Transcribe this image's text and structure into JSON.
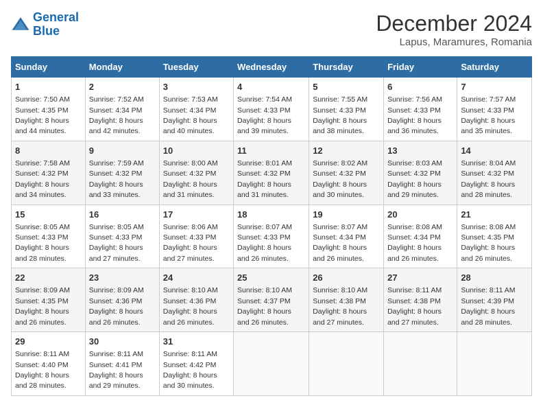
{
  "logo": {
    "line1": "General",
    "line2": "Blue"
  },
  "title": "December 2024",
  "location": "Lapus, Maramures, Romania",
  "days_of_week": [
    "Sunday",
    "Monday",
    "Tuesday",
    "Wednesday",
    "Thursday",
    "Friday",
    "Saturday"
  ],
  "weeks": [
    [
      {
        "day": 1,
        "sunrise": "7:50 AM",
        "sunset": "4:35 PM",
        "daylight": "8 hours and 44 minutes."
      },
      {
        "day": 2,
        "sunrise": "7:52 AM",
        "sunset": "4:34 PM",
        "daylight": "8 hours and 42 minutes."
      },
      {
        "day": 3,
        "sunrise": "7:53 AM",
        "sunset": "4:34 PM",
        "daylight": "8 hours and 40 minutes."
      },
      {
        "day": 4,
        "sunrise": "7:54 AM",
        "sunset": "4:33 PM",
        "daylight": "8 hours and 39 minutes."
      },
      {
        "day": 5,
        "sunrise": "7:55 AM",
        "sunset": "4:33 PM",
        "daylight": "8 hours and 38 minutes."
      },
      {
        "day": 6,
        "sunrise": "7:56 AM",
        "sunset": "4:33 PM",
        "daylight": "8 hours and 36 minutes."
      },
      {
        "day": 7,
        "sunrise": "7:57 AM",
        "sunset": "4:33 PM",
        "daylight": "8 hours and 35 minutes."
      }
    ],
    [
      {
        "day": 8,
        "sunrise": "7:58 AM",
        "sunset": "4:32 PM",
        "daylight": "8 hours and 34 minutes."
      },
      {
        "day": 9,
        "sunrise": "7:59 AM",
        "sunset": "4:32 PM",
        "daylight": "8 hours and 33 minutes."
      },
      {
        "day": 10,
        "sunrise": "8:00 AM",
        "sunset": "4:32 PM",
        "daylight": "8 hours and 31 minutes."
      },
      {
        "day": 11,
        "sunrise": "8:01 AM",
        "sunset": "4:32 PM",
        "daylight": "8 hours and 31 minutes."
      },
      {
        "day": 12,
        "sunrise": "8:02 AM",
        "sunset": "4:32 PM",
        "daylight": "8 hours and 30 minutes."
      },
      {
        "day": 13,
        "sunrise": "8:03 AM",
        "sunset": "4:32 PM",
        "daylight": "8 hours and 29 minutes."
      },
      {
        "day": 14,
        "sunrise": "8:04 AM",
        "sunset": "4:32 PM",
        "daylight": "8 hours and 28 minutes."
      }
    ],
    [
      {
        "day": 15,
        "sunrise": "8:05 AM",
        "sunset": "4:33 PM",
        "daylight": "8 hours and 28 minutes."
      },
      {
        "day": 16,
        "sunrise": "8:05 AM",
        "sunset": "4:33 PM",
        "daylight": "8 hours and 27 minutes."
      },
      {
        "day": 17,
        "sunrise": "8:06 AM",
        "sunset": "4:33 PM",
        "daylight": "8 hours and 27 minutes."
      },
      {
        "day": 18,
        "sunrise": "8:07 AM",
        "sunset": "4:33 PM",
        "daylight": "8 hours and 26 minutes."
      },
      {
        "day": 19,
        "sunrise": "8:07 AM",
        "sunset": "4:34 PM",
        "daylight": "8 hours and 26 minutes."
      },
      {
        "day": 20,
        "sunrise": "8:08 AM",
        "sunset": "4:34 PM",
        "daylight": "8 hours and 26 minutes."
      },
      {
        "day": 21,
        "sunrise": "8:08 AM",
        "sunset": "4:35 PM",
        "daylight": "8 hours and 26 minutes."
      }
    ],
    [
      {
        "day": 22,
        "sunrise": "8:09 AM",
        "sunset": "4:35 PM",
        "daylight": "8 hours and 26 minutes."
      },
      {
        "day": 23,
        "sunrise": "8:09 AM",
        "sunset": "4:36 PM",
        "daylight": "8 hours and 26 minutes."
      },
      {
        "day": 24,
        "sunrise": "8:10 AM",
        "sunset": "4:36 PM",
        "daylight": "8 hours and 26 minutes."
      },
      {
        "day": 25,
        "sunrise": "8:10 AM",
        "sunset": "4:37 PM",
        "daylight": "8 hours and 26 minutes."
      },
      {
        "day": 26,
        "sunrise": "8:10 AM",
        "sunset": "4:38 PM",
        "daylight": "8 hours and 27 minutes."
      },
      {
        "day": 27,
        "sunrise": "8:11 AM",
        "sunset": "4:38 PM",
        "daylight": "8 hours and 27 minutes."
      },
      {
        "day": 28,
        "sunrise": "8:11 AM",
        "sunset": "4:39 PM",
        "daylight": "8 hours and 28 minutes."
      }
    ],
    [
      {
        "day": 29,
        "sunrise": "8:11 AM",
        "sunset": "4:40 PM",
        "daylight": "8 hours and 28 minutes."
      },
      {
        "day": 30,
        "sunrise": "8:11 AM",
        "sunset": "4:41 PM",
        "daylight": "8 hours and 29 minutes."
      },
      {
        "day": 31,
        "sunrise": "8:11 AM",
        "sunset": "4:42 PM",
        "daylight": "8 hours and 30 minutes."
      },
      null,
      null,
      null,
      null
    ]
  ]
}
